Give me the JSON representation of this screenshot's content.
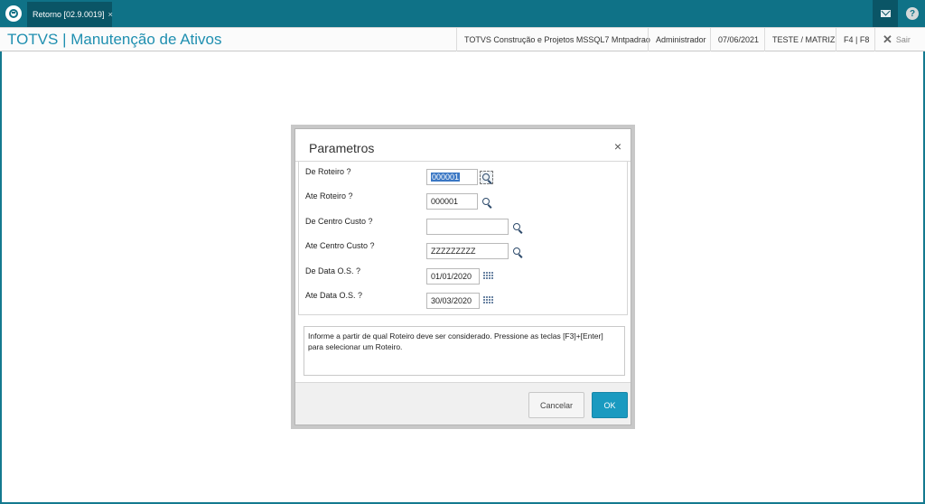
{
  "window": {
    "tab_label": "Retorno [02.9.0019]",
    "tab_close": "×",
    "icons": [
      "logo-icon",
      "mail-icon",
      "help-icon"
    ],
    "help_glyph": "?"
  },
  "header": {
    "title": "TOTVS | Manutenção de Ativos",
    "environment": "TOTVS Construção e Projetos MSSQL7 Mntpadrao",
    "user": "Administrador",
    "date": "07/06/2021",
    "branch": "TESTE / MATRIZ",
    "keys": "F4 | F8",
    "exit_icon": "✕",
    "exit_label": "Sair"
  },
  "dialog": {
    "title": "Parametros",
    "close": "×",
    "params": [
      {
        "label": "De  Roteiro ?",
        "value": "000001",
        "lookup": "search"
      },
      {
        "label": "Ate Roteiro ?",
        "value": "000001",
        "lookup": "search"
      },
      {
        "label": "De  Centro Custo ?",
        "value": "",
        "lookup": "search"
      },
      {
        "label": "Ate Centro Custo ?",
        "value": "ZZZZZZZZZ",
        "lookup": "search"
      },
      {
        "label": "De  Data O.S. ?",
        "value": "01/01/2020",
        "lookup": "calendar"
      },
      {
        "label": "Ate Data O.S. ?",
        "value": "30/03/2020",
        "lookup": "calendar"
      }
    ],
    "help_text": "Informe a partir de qual Roteiro deve ser considerado. Pressione as teclas [F3]+[Enter] para selecionar um Roteiro.",
    "cancel_label": "Cancelar",
    "ok_label": "OK"
  },
  "colors": {
    "topbar": "#0f7287",
    "title": "#1f8fb0",
    "ok_button": "#1a9ac0"
  }
}
